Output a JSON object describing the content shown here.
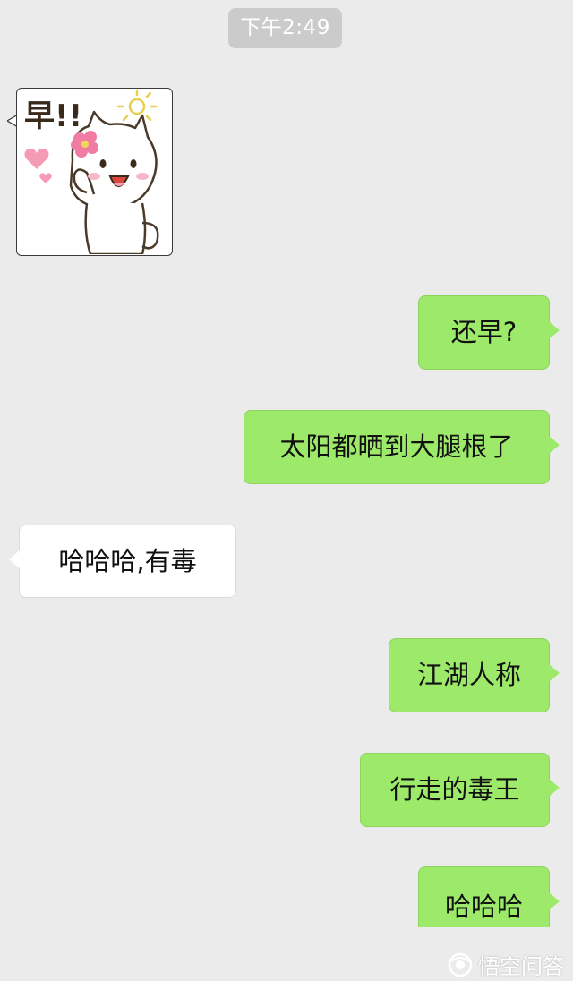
{
  "chat": {
    "timestamp": "下午2:49",
    "sticker": {
      "text": "早!!",
      "icon": "cat-sticker-icon"
    },
    "messages": [
      {
        "id": "m1",
        "side": "out",
        "text": "还早?"
      },
      {
        "id": "m2",
        "side": "out",
        "text": "太阳都晒到大腿根了"
      },
      {
        "id": "m3",
        "side": "in",
        "text": "哈哈哈,有毒"
      },
      {
        "id": "m4",
        "side": "out",
        "text": "江湖人称"
      },
      {
        "id": "m5",
        "side": "out",
        "text": "行走的毒王"
      },
      {
        "id": "m6",
        "side": "out",
        "text": "哈哈哈"
      }
    ]
  },
  "watermark": {
    "text": "悟空问答",
    "icon": "wukong-logo-icon"
  },
  "colors": {
    "background": "#ebebeb",
    "outgoing_bubble": "#9dea6a",
    "incoming_bubble": "#ffffff",
    "timestamp_pill": "#cbcbcb"
  }
}
